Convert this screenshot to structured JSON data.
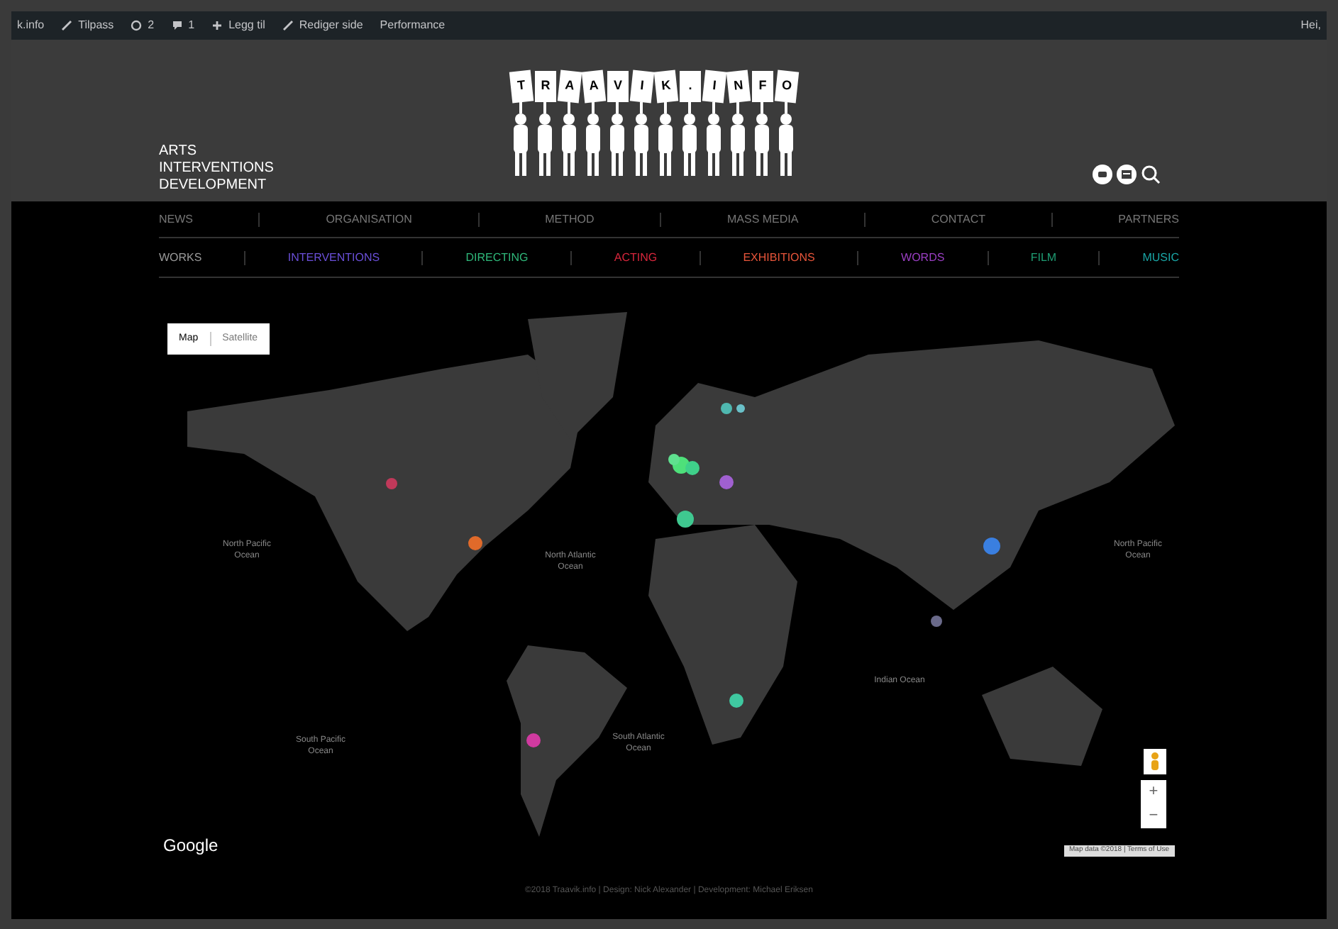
{
  "admin_bar": {
    "items": [
      {
        "kind": "text",
        "label": "k.info"
      },
      {
        "kind": "pencil",
        "label": "Tilpass"
      },
      {
        "kind": "refresh",
        "label": "2"
      },
      {
        "kind": "comment",
        "label": "1"
      },
      {
        "kind": "plus",
        "label": "Legg til"
      },
      {
        "kind": "pencil",
        "label": "Rediger side"
      },
      {
        "kind": "text",
        "label": "Performance"
      }
    ],
    "greeting": "Hei,"
  },
  "header": {
    "tagline": [
      "ARTS",
      "INTERVENTIONS",
      "DEVELOPMENT"
    ],
    "logo_letters": [
      "T",
      "R",
      "A",
      "A",
      "V",
      "I",
      "K",
      ".",
      "I",
      "N",
      "F",
      "O"
    ]
  },
  "main_nav": [
    {
      "label": "NEWS"
    },
    {
      "label": "ORGANISATION"
    },
    {
      "label": "METHOD"
    },
    {
      "label": "MASS MEDIA"
    },
    {
      "label": "CONTACT"
    },
    {
      "label": "PARTNERS"
    }
  ],
  "works_nav": [
    {
      "label": "WORKS",
      "color": "#9a9a9a"
    },
    {
      "label": "INTERVENTIONS",
      "color": "#6a4fd8"
    },
    {
      "label": "DIRECTING",
      "color": "#2fb87a"
    },
    {
      "label": "ACTING",
      "color": "#d8263c"
    },
    {
      "label": "EXHIBITIONS",
      "color": "#e8553a"
    },
    {
      "label": "WORDS",
      "color": "#9b3fc4"
    },
    {
      "label": "FILM",
      "color": "#1f9e74"
    },
    {
      "label": "MUSIC",
      "color": "#1aa6a6"
    }
  ],
  "map": {
    "type_toggle": [
      {
        "label": "Map",
        "selected": true
      },
      {
        "label": "Satellite",
        "selected": false
      }
    ],
    "ocean_labels": [
      "North Pacific Ocean",
      "North Atlantic Ocean",
      "South Pacific Ocean",
      "South Atlantic Ocean",
      "Indian Ocean",
      "North Pacific Ocean"
    ],
    "markers": [
      {
        "color": "#c0395a"
      },
      {
        "color": "#e06a2a"
      },
      {
        "color": "#4ee07a"
      },
      {
        "color": "#3fd08a"
      },
      {
        "color": "#5fe08f"
      },
      {
        "color": "#4fb8b0"
      },
      {
        "color": "#6ac0c8"
      },
      {
        "color": "#a060d0"
      },
      {
        "color": "#3fc890"
      },
      {
        "color": "#3a7fe0"
      },
      {
        "color": "#3fc8a0"
      },
      {
        "color": "#d03aa0"
      },
      {
        "color": "#6a6a8a"
      }
    ],
    "provider_logo": "Google",
    "zoom_in": "+",
    "zoom_out": "−",
    "attribution": "Map data ©2018 | Terms of Use"
  },
  "footer": "©2018 Traavik.info | Design: Nick Alexander | Development: Michael Eriksen"
}
